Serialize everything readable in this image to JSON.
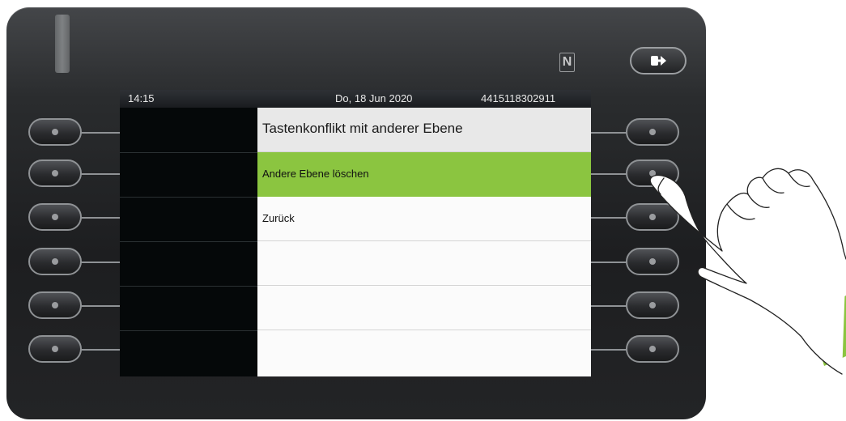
{
  "status_bar": {
    "time": "14:15",
    "date": "Do, 18 Jun 2020",
    "number": "4415118302911"
  },
  "menu": {
    "title": "Tastenkonflikt mit anderer Ebene",
    "options": [
      "Andere Ebene löschen",
      "Zurück"
    ],
    "selected_index": 0
  },
  "device": {
    "nfc_label": "N",
    "icons": [
      "nfc-icon",
      "leave-icon",
      "led-indicator"
    ]
  },
  "colors": {
    "selection": "#8bc540",
    "cuff": "#8bc540"
  }
}
